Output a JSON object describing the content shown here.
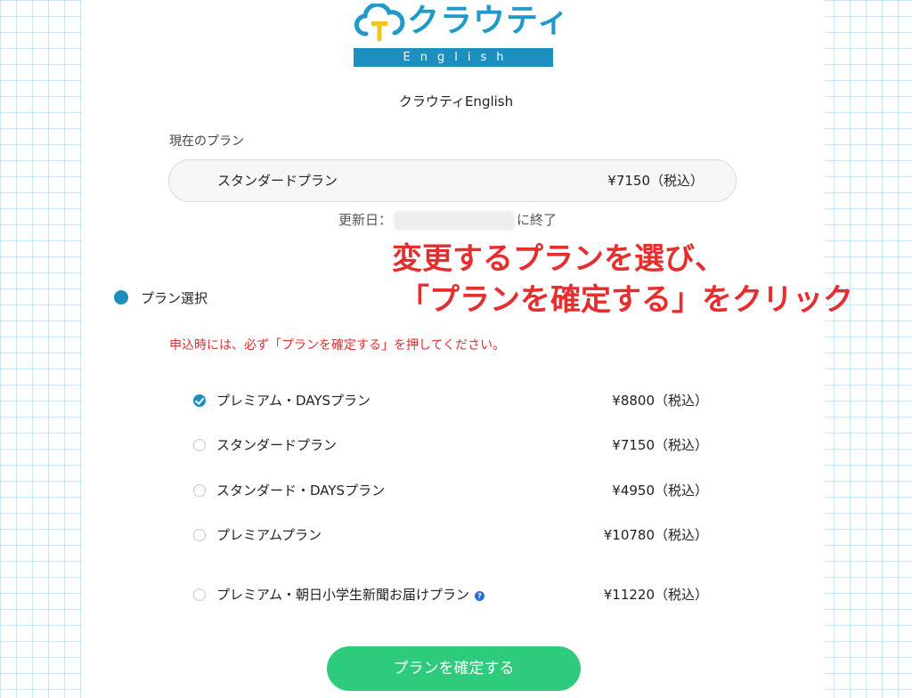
{
  "brand": {
    "logo_text": "クラウティ",
    "logo_subtext": "English",
    "service_name": "クラウティEnglish",
    "logo_color": "#1f9ac9",
    "band_color": "#1d8fbf"
  },
  "current_plan": {
    "label": "現在のプラン",
    "name": "スタンダードプラン",
    "price": "¥7150（税込）",
    "renewal_prefix": "更新日：",
    "renewal_suffix": "に終了"
  },
  "annotation": {
    "line1": "変更するプランを選び、",
    "line2": "「プランを確定する」をクリック",
    "color": "#e52e2e"
  },
  "plan_selection": {
    "heading": "プラン選択",
    "notice": "申込時には、必ず「プランを確定する」を押してください。",
    "options": [
      {
        "name": "プレミアム・DAYSプラン",
        "price": "¥8800（税込）",
        "selected": true
      },
      {
        "name": "スタンダードプラン",
        "price": "¥7150（税込）",
        "selected": false
      },
      {
        "name": "スタンダード・DAYSプラン",
        "price": "¥4950（税込）",
        "selected": false
      },
      {
        "name": "プレミアムプラン",
        "price": "¥10780（税込）",
        "selected": false
      },
      {
        "name": "プレミアム・朝日小学生新聞お届けプラン",
        "price": "¥11220（税込）",
        "selected": false,
        "help_icon": "question-icon"
      }
    ]
  },
  "confirm": {
    "label": "プランを確定する",
    "color": "#2ecb7d"
  },
  "colors": {
    "accent": "#1990be",
    "warning": "#e32e2e"
  }
}
